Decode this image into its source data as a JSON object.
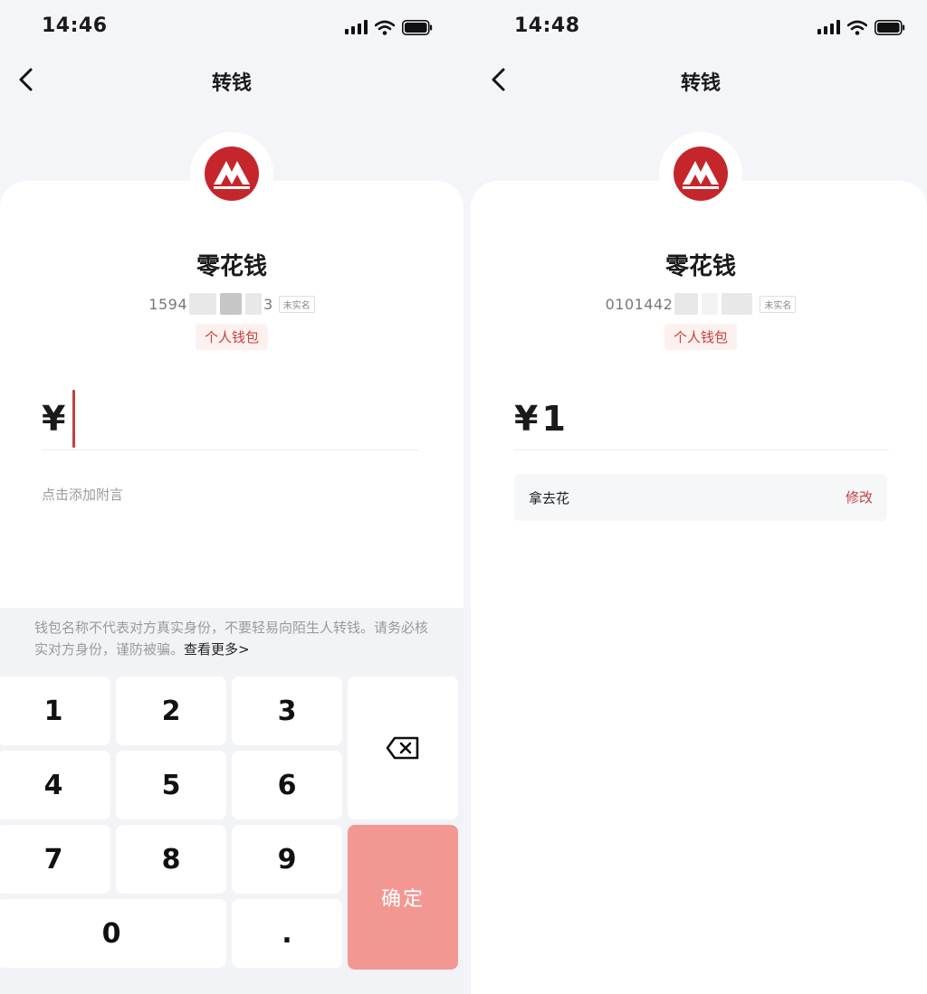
{
  "left": {
    "status": {
      "time": "14:46"
    },
    "nav": {
      "title": "转钱"
    },
    "wallet": {
      "name": "零花钱",
      "account_prefix": "1594",
      "account_suffix": "3",
      "verify_badge": "未实名",
      "type": "个人钱包"
    },
    "amount": {
      "currency": "¥",
      "value": ""
    },
    "memo": {
      "placeholder": "点击添加附言"
    },
    "warning": {
      "text": "钱包名称不代表对方真实身份，不要轻易向陌生人转钱。请务必核实对方身份，谨防被骗。",
      "more": "查看更多>"
    },
    "keypad": {
      "keys": [
        "1",
        "2",
        "3",
        "4",
        "5",
        "6",
        "7",
        "8",
        "9",
        "0",
        "."
      ],
      "confirm": "确定"
    }
  },
  "right": {
    "status": {
      "time": "14:48"
    },
    "nav": {
      "title": "转钱"
    },
    "wallet": {
      "name": "零花钱",
      "account_prefix": "0101442",
      "verify_badge": "未实名",
      "type": "个人钱包"
    },
    "amount": {
      "currency": "¥",
      "value": "1"
    },
    "memo": {
      "text": "拿去花",
      "edit": "修改"
    }
  },
  "colors": {
    "accent": "#c5413b",
    "confirm": "#f39793",
    "background": "#f4f5f8"
  },
  "icons": [
    "back-arrow-icon",
    "cellular-signal-icon",
    "wifi-icon",
    "battery-icon",
    "bank-logo-icon",
    "backspace-icon"
  ]
}
